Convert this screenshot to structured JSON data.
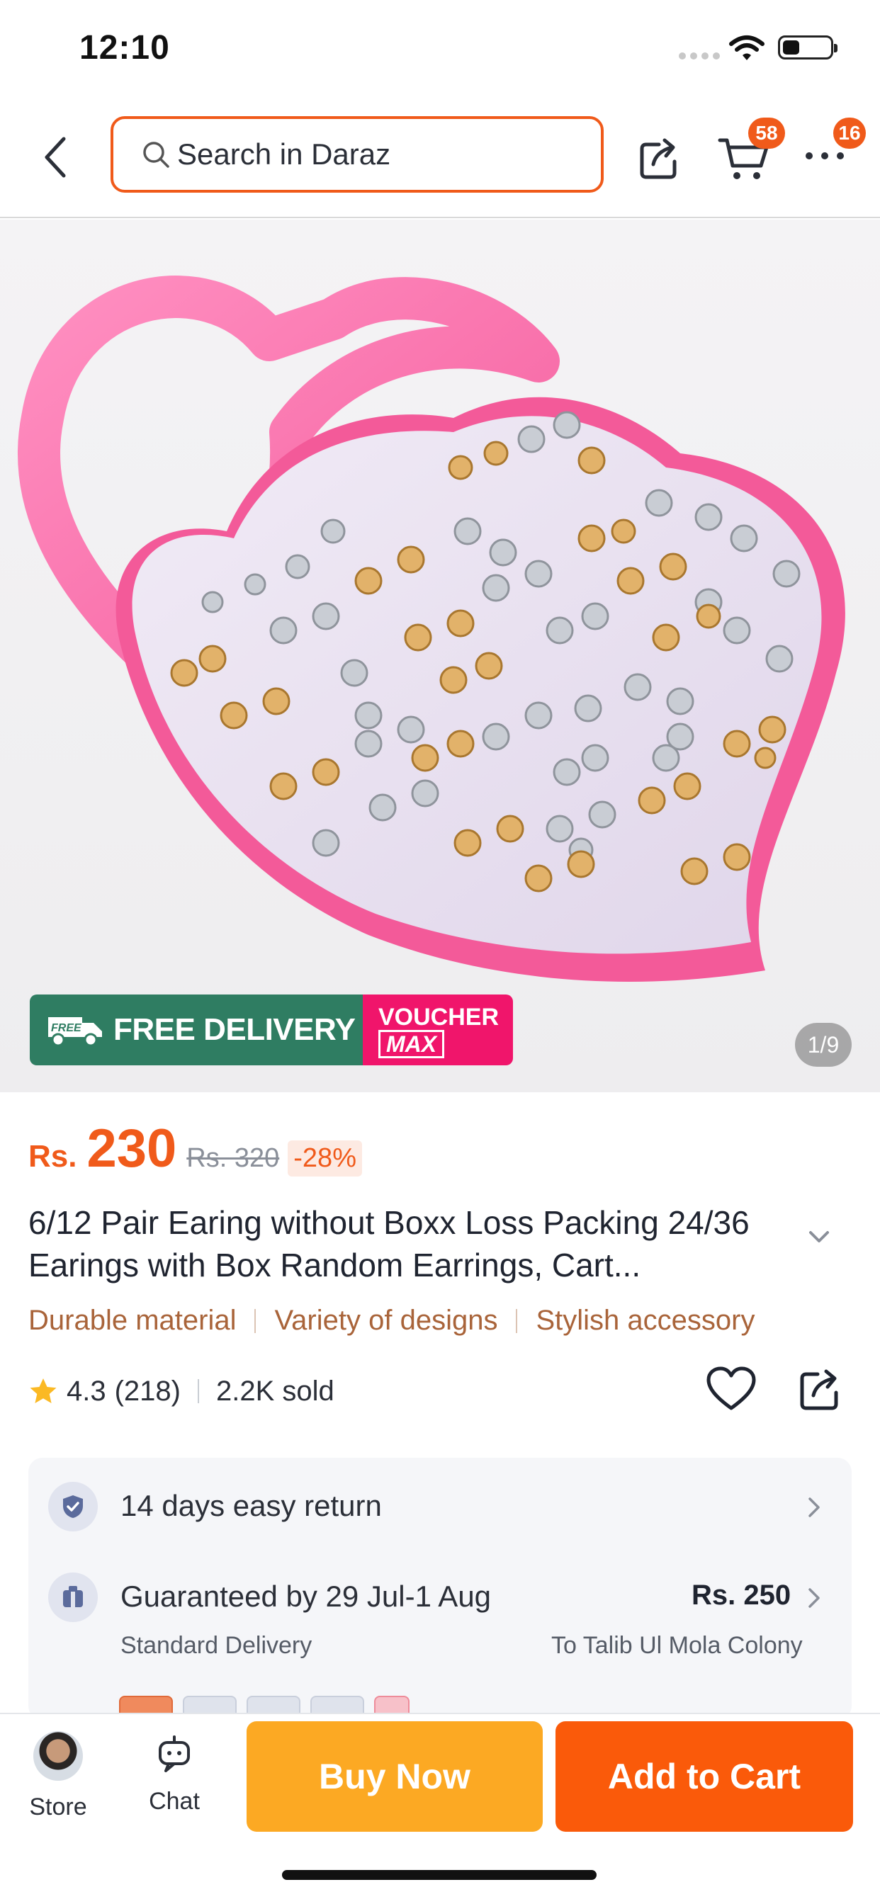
{
  "status_bar": {
    "time": "12:10",
    "battery_level": 0.35
  },
  "header": {
    "search_placeholder": "Search in Daraz",
    "cart_badge": "58",
    "more_badge": "16"
  },
  "gallery": {
    "banner_free_delivery": "FREE DELIVERY",
    "banner_truck_label": "FREE",
    "voucher_top": "VOUCHER",
    "voucher_bottom": "MAX",
    "page_indicator": "1/9"
  },
  "price": {
    "currency": "Rs.",
    "value": "230",
    "original": "Rs. 320",
    "discount": "-28%"
  },
  "product": {
    "title": "6/12 Pair  Earing without Boxx Loss Packing 24/36 Earings with Box Random Earrings, Cart...",
    "features": [
      "Durable material",
      "Variety of designs",
      "Stylish accessory"
    ]
  },
  "rating": {
    "score": "4.3",
    "count": "(218)",
    "sold": "2.2K sold"
  },
  "info": {
    "return_policy": "14 days easy return",
    "delivery_guarantee": "Guaranteed by 29 Jul-1 Aug",
    "delivery_price": "Rs. 250",
    "delivery_type": "Standard Delivery",
    "delivery_destination": "To Talib Ul Mola Colony"
  },
  "bottom_bar": {
    "store_label": "Store",
    "chat_label": "Chat",
    "buy_now_label": "Buy Now",
    "add_to_cart_label": "Add to Cart"
  },
  "colors": {
    "brand_orange": "#f05a1a",
    "buy_now": "#fca923",
    "add_to_cart": "#fa5a0a",
    "free_delivery_green": "#2f7d62",
    "voucher_pink": "#f0156b",
    "feature_brown": "#a9643a"
  }
}
